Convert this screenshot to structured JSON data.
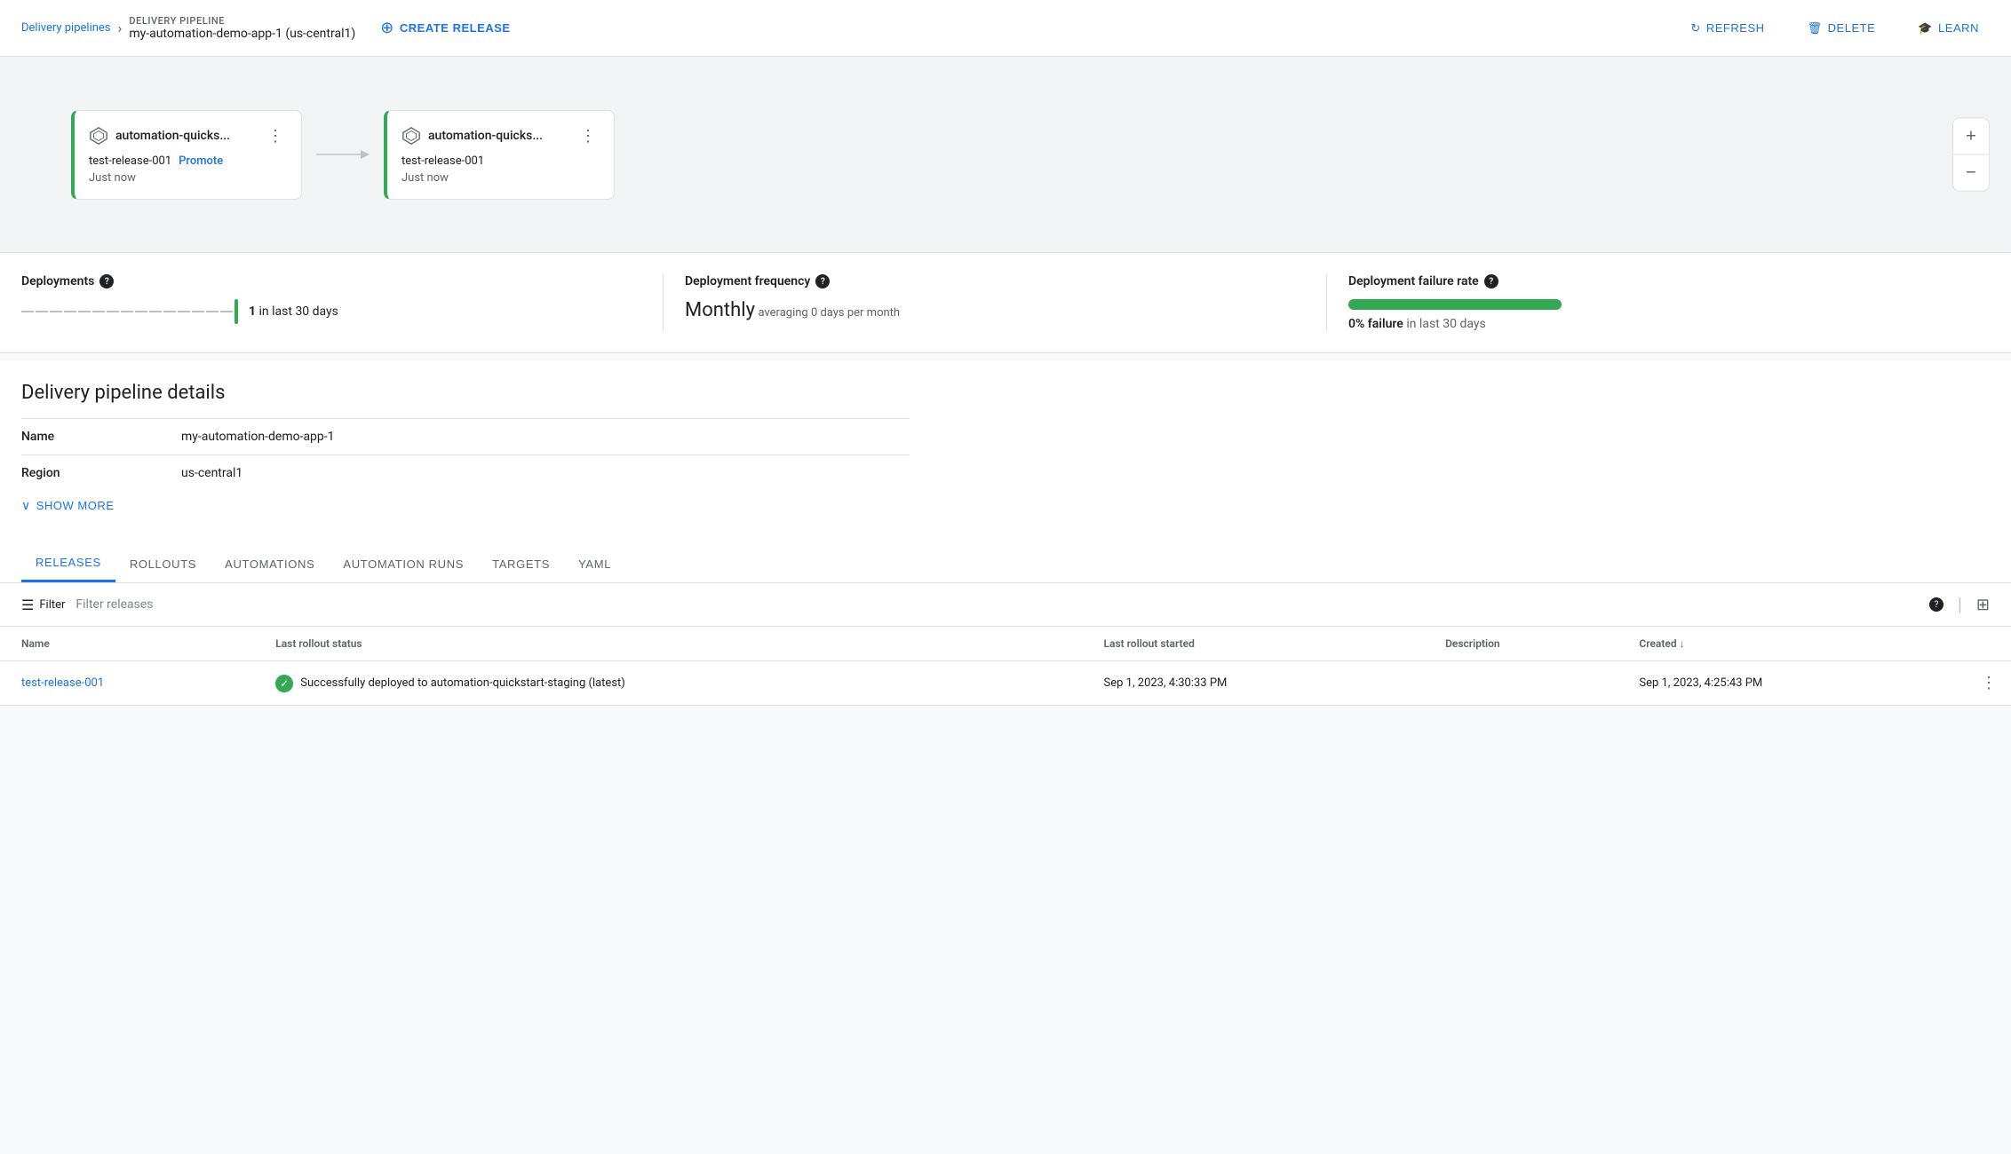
{
  "header": {
    "breadcrumb_link": "Delivery pipelines",
    "pipeline_label": "DELIVERY PIPELINE",
    "pipeline_name": "my-automation-demo-app-1 (us-central1)",
    "create_release": "CREATE RELEASE",
    "refresh": "REFRESH",
    "delete": "DELETE",
    "learn": "LEARN"
  },
  "pipeline": {
    "stages": [
      {
        "name": "automation-quicks...",
        "release": "test-release-001",
        "promote_label": "Promote",
        "time": "Just now"
      },
      {
        "name": "automation-quicks...",
        "release": "test-release-001",
        "promote_label": null,
        "time": "Just now"
      }
    ]
  },
  "metrics": {
    "deployments_title": "Deployments",
    "deployments_count": "1",
    "deployments_period": "in last 30 days",
    "frequency_title": "Deployment frequency",
    "frequency_value": "Monthly",
    "frequency_sub": "averaging 0 days per month",
    "failure_title": "Deployment failure rate",
    "failure_value": "0% failure",
    "failure_sub": "in last 30 days",
    "failure_pct": 0
  },
  "details": {
    "title": "Delivery pipeline details",
    "fields": [
      {
        "label": "Name",
        "value": "my-automation-demo-app-1"
      },
      {
        "label": "Region",
        "value": "us-central1"
      }
    ],
    "show_more": "SHOW MORE"
  },
  "tabs": [
    {
      "id": "releases",
      "label": "RELEASES",
      "active": true
    },
    {
      "id": "rollouts",
      "label": "ROLLOUTS",
      "active": false
    },
    {
      "id": "automations",
      "label": "AUTOMATIONS",
      "active": false
    },
    {
      "id": "automation-runs",
      "label": "AUTOMATION RUNS",
      "active": false
    },
    {
      "id": "targets",
      "label": "TARGETS",
      "active": false
    },
    {
      "id": "yaml",
      "label": "YAML",
      "active": false
    }
  ],
  "filter": {
    "label": "Filter",
    "placeholder": "Filter releases"
  },
  "table": {
    "columns": [
      {
        "id": "name",
        "label": "Name",
        "sortable": false
      },
      {
        "id": "status",
        "label": "Last rollout status",
        "sortable": false
      },
      {
        "id": "started",
        "label": "Last rollout started",
        "sortable": false
      },
      {
        "id": "description",
        "label": "Description",
        "sortable": false
      },
      {
        "id": "created",
        "label": "Created",
        "sortable": true,
        "sort_dir": "desc"
      }
    ],
    "rows": [
      {
        "name": "test-release-001",
        "status_text": "Successfully deployed to automation-quickstart-staging (latest)",
        "status_ok": true,
        "started": "Sep 1, 2023, 4:30:33 PM",
        "description": "",
        "created": "Sep 1, 2023, 4:25:43 PM"
      }
    ]
  },
  "icons": {
    "chevron_right": "›",
    "menu_dots": "⋮",
    "zoom_plus": "+",
    "zoom_minus": "−",
    "check": "✓",
    "filter": "☰",
    "help": "?",
    "columns": "|||",
    "arrow_down": "↓",
    "chevron_down": "∨",
    "refresh_symbol": "↻",
    "delete_symbol": "🗑",
    "learn_symbol": "🎓"
  }
}
